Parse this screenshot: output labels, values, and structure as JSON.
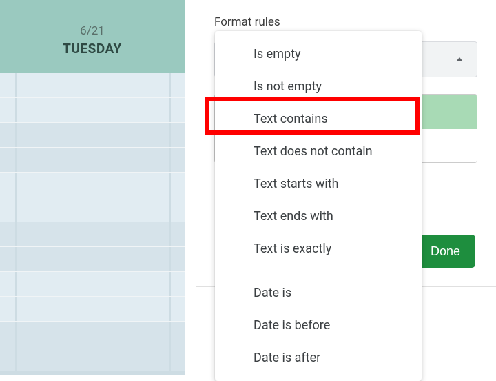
{
  "calendar": {
    "date": "6/21",
    "day": "TUESDAY"
  },
  "panel": {
    "title": "Format rules",
    "done": "Done"
  },
  "dropdown": {
    "items": [
      "Is empty",
      "Is not empty",
      "Text contains",
      "Text does not contain",
      "Text starts with",
      "Text ends with",
      "Text is exactly"
    ],
    "items2": [
      "Date is",
      "Date is before",
      "Date is after"
    ]
  }
}
